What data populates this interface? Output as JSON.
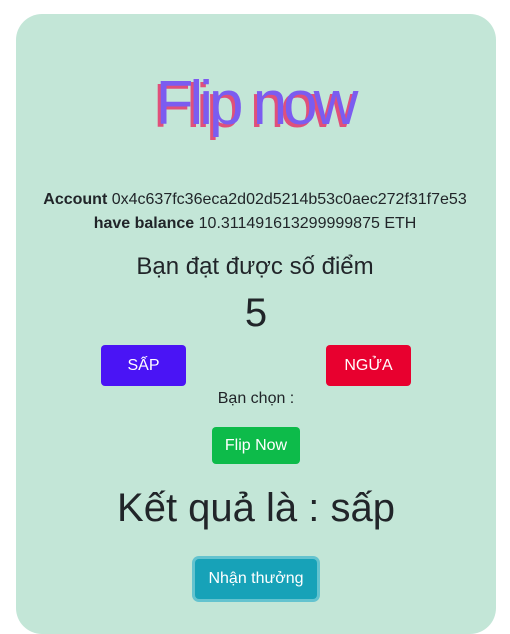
{
  "title": "Flip now",
  "account": {
    "account_label": "Account",
    "account_value": "0x4c637fc36eca2d02d5214b53c0aec272f31f7e53",
    "balance_label": "have balance",
    "balance_value": "10.311491613299999875 ETH"
  },
  "score": {
    "label": "Bạn đạt được số điểm",
    "value": "5"
  },
  "choices": {
    "sap_label": "SẤP",
    "ngua_label": "NGỬA",
    "chosen_label": "Bạn chọn :"
  },
  "flip_button_label": "Flip Now",
  "result_text": "Kết quả là : sấp",
  "reward_button_label": "Nhận thưởng",
  "colors": {
    "card_bg": "#c3e6d7",
    "sap_button": "#4a14f5",
    "ngua_button": "#e8002f",
    "flip_button": "#0dbb4a",
    "reward_button": "#17a2b8",
    "title_main": "#7b5cf0",
    "title_shadow": "#e0507a"
  }
}
